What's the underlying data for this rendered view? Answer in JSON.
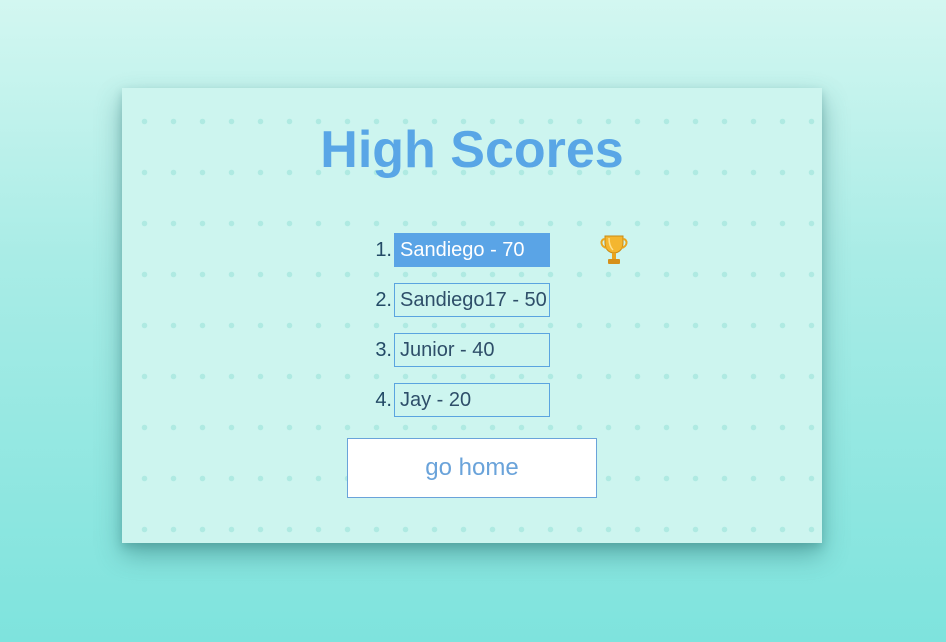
{
  "page": {
    "title": "High Scores",
    "scores": [
      {
        "rank": "1.",
        "text": "Sandiego - 70"
      },
      {
        "rank": "2.",
        "text": "Sandiego17 - 50"
      },
      {
        "rank": "3.",
        "text": "Junior - 40"
      },
      {
        "rank": "4.",
        "text": "Jay - 20"
      }
    ],
    "trophy_icon": "trophy-icon",
    "home_button_label": "go home"
  },
  "colors": {
    "title": "#59a6e6",
    "highlight": "#5aa4e6",
    "button_text": "#6aa3da"
  }
}
